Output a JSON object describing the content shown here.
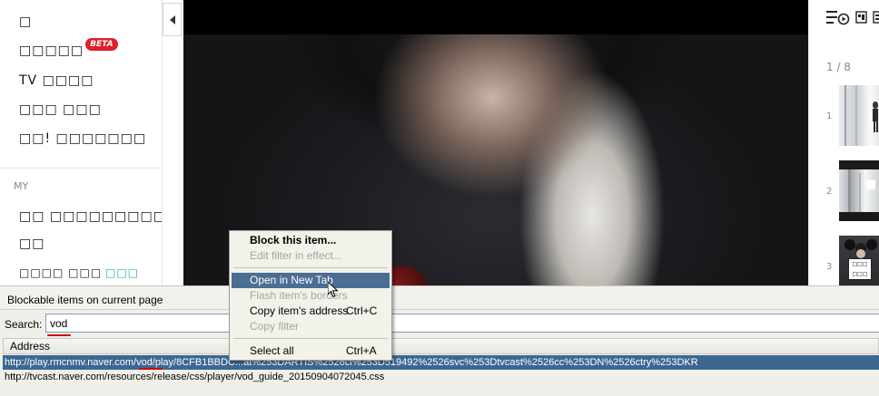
{
  "sidebar": {
    "menu": [
      {
        "label": "□"
      },
      {
        "label": "□□□□□",
        "badge": "BETA"
      },
      {
        "label": "TV □□□□"
      },
      {
        "label": "□□□ □□□"
      },
      {
        "label": "□□! □□□□□□□"
      }
    ],
    "section_label": "MY",
    "my_items": [
      {
        "label": "□□ □□□□□□□□□"
      },
      {
        "label": "□□"
      },
      {
        "label": "□□□□ □□□",
        "accent": "□□□"
      }
    ]
  },
  "playlist": {
    "page_count": "1 / 8",
    "items": [
      {
        "num": "1",
        "icon": "thumbnail-image"
      },
      {
        "num": "2",
        "icon": "thumbnail-image"
      },
      {
        "num": "3",
        "icon": "thumbnail-image",
        "sign_text": "□□□ □□□"
      }
    ]
  },
  "panel": {
    "title": "Blockable items on current page",
    "search_label": "Search:",
    "search_value": "vod",
    "column_header": "Address",
    "rows": [
      "http://play.rmcnmv.naver.com/vod/play/8CFB1BBDC...at%253DARTIS%2526cl%253D519492%2526svc%253Dtvcast%2526cc%253DN%2526ctry%253DKR",
      "http://tvcast.naver.com/resources/release/css/player/vod_guide_20150904072045.css"
    ]
  },
  "context_menu": {
    "block_item": "Block this item...",
    "edit_filter": "Edit filter in effect...",
    "open_new_tab": "Open in New Tab",
    "flash_borders": "Flash item's borders",
    "copy_address": "Copy item's address",
    "copy_address_shortcut": "Ctrl+C",
    "copy_filter": "Copy filter",
    "select_all": "Select all",
    "select_all_shortcut": "Ctrl+A"
  },
  "colors": {
    "selection": "#3d6793",
    "menu_hover": "#4b6e95",
    "beta_badge": "#e01f2d",
    "accent_teal": "#23b0a0",
    "annotation_red": "#d40000"
  }
}
